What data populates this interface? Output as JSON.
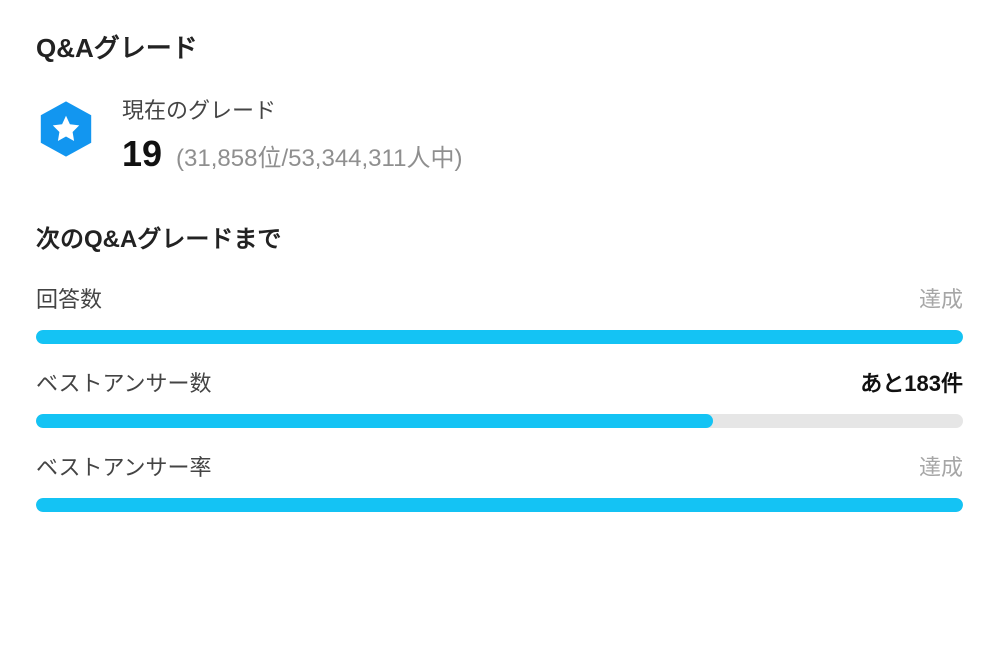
{
  "section": {
    "title": "Q&Aグレード"
  },
  "grade": {
    "label": "現在のグレード",
    "value": "19",
    "rank": "(31,858位/53,344,311人中)"
  },
  "nextGrade": {
    "title": "次のQ&Aグレードまで"
  },
  "progress": {
    "items": [
      {
        "label": "回答数",
        "status": "達成",
        "statusType": "complete",
        "percent": 100
      },
      {
        "label": "ベストアンサー数",
        "status": "あと183件",
        "statusType": "remaining",
        "percent": 73
      },
      {
        "label": "ベストアンサー率",
        "status": "達成",
        "statusType": "complete",
        "percent": 100
      }
    ]
  },
  "colors": {
    "accent": "#14c3f4",
    "badge": "#1296f0"
  }
}
